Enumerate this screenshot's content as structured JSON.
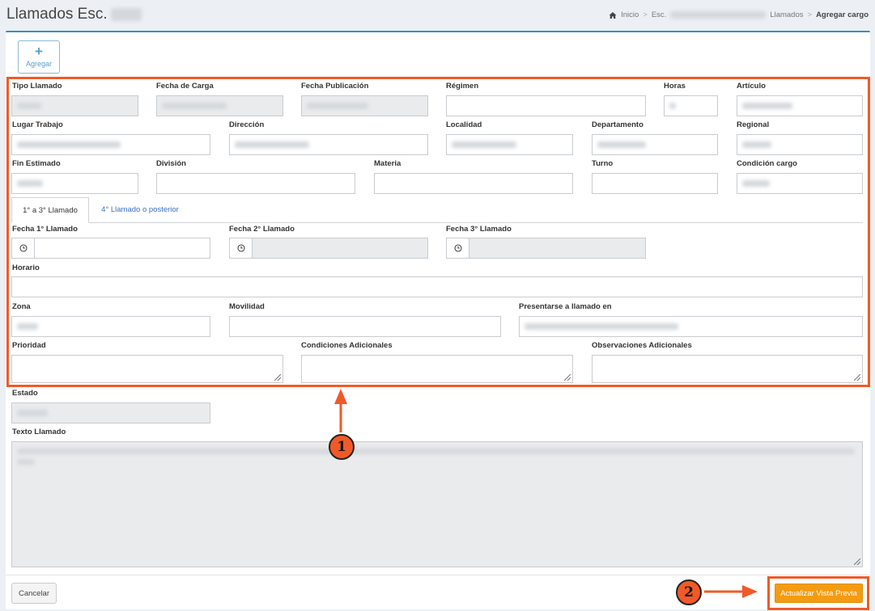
{
  "header": {
    "title": "Llamados Esc.",
    "breadcrumb": [
      "Inicio",
      "Esc.",
      "Llamados",
      "Agregar cargo"
    ]
  },
  "toolbar": {
    "add_label": "Agregar"
  },
  "form": {
    "tipo_llamado": "Tipo Llamado",
    "fecha_carga": "Fecha de Carga",
    "fecha_carga_value": "20/05/2022 09:20",
    "fecha_publicacion": "Fecha Publicación",
    "fecha_publicacion_value": "20/05/2022 09:22",
    "regimen": "Régimen",
    "horas": "Horas",
    "horas_value": "3",
    "articulo": "Artículo",
    "articulo_value": "Cargo vacante",
    "lugar_trabajo": "Lugar Trabajo",
    "direccion": "Dirección",
    "localidad": "Localidad",
    "departamento": "Departamento",
    "regional": "Regional",
    "fin_estimado": "Fin Estimado",
    "fin_estimado_value": "C.Dueño",
    "division": "División",
    "materia": "Materia",
    "turno": "Turno",
    "condicion_cargo": "Condición cargo",
    "tabs": [
      "1° a 3° Llamado",
      "4° Llamado o posterior"
    ],
    "fecha_1": "Fecha 1° Llamado",
    "fecha_2": "Fecha 2° Llamado",
    "fecha_3": "Fecha 3° Llamado",
    "horario": "Horario",
    "zona": "Zona",
    "movilidad": "Movilidad",
    "presentarse": "Presentarse a llamado en",
    "presentarse_value": "Presentarse en GEM PAD - Llamado Virtual",
    "prioridad": "Prioridad",
    "condiciones_adicionales": "Condiciones Adicionales",
    "observaciones_adicionales": "Observaciones Adicionales",
    "estado": "Estado",
    "estado_value": "Pendiente",
    "texto_llamado": "Texto Llamado"
  },
  "footer": {
    "cancel_label": "Cancelar",
    "preview_label": "Actualizar Vista Previa"
  },
  "annotations": {
    "marker_1": "1",
    "marker_2": "2"
  },
  "colors": {
    "highlight": "#f05a28",
    "preview_button": "#f39c12",
    "box_top_border": "#3c8dbc",
    "tab_link": "#3a6fc4"
  }
}
